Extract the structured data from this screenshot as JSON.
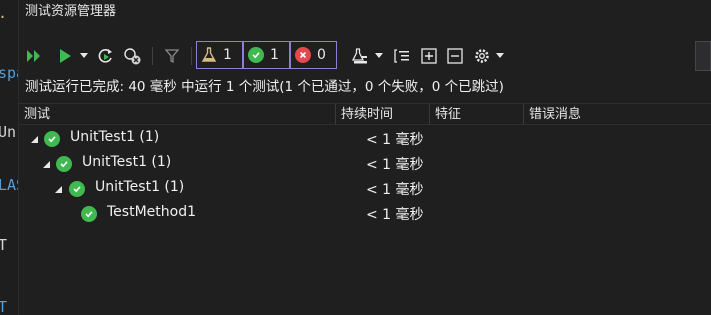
{
  "window": {
    "title": "测试资源管理器"
  },
  "editor_strip": {
    "fragments": [
      "spa",
      "Un",
      "LAS",
      "T",
      "T"
    ]
  },
  "toolbar": {
    "counters": {
      "total": "1",
      "passed": "1",
      "failed": "0"
    },
    "icons": [
      "run-all-icon",
      "run-icon",
      "dropdown-icon",
      "repeat-last-run-icon",
      "cancel-icon",
      "filter-icon",
      "playlist-icon",
      "group-by-icon",
      "expand-all-icon",
      "collapse-all-icon",
      "settings-icon"
    ],
    "colors": {
      "accent_border": "#8b7fd8",
      "passed": "#3fb950",
      "failed": "#e5484d",
      "run": "#3fb950"
    }
  },
  "summary": {
    "text": "测试运行已完成: 40 毫秒 中运行 1 个测试(1 个已通过，0 个失败，0 个已跳过)"
  },
  "columns": {
    "test": "测试",
    "duration": "持续时间",
    "traits": "特征",
    "error": "错误消息"
  },
  "tree": [
    {
      "name": "UnitTest1 (1)",
      "duration": "< 1 毫秒"
    },
    {
      "name": "UnitTest1 (1)",
      "duration": "< 1 毫秒"
    },
    {
      "name": "UnitTest1 (1)",
      "duration": "< 1 毫秒"
    },
    {
      "name": "TestMethod1",
      "duration": "< 1 毫秒"
    }
  ]
}
